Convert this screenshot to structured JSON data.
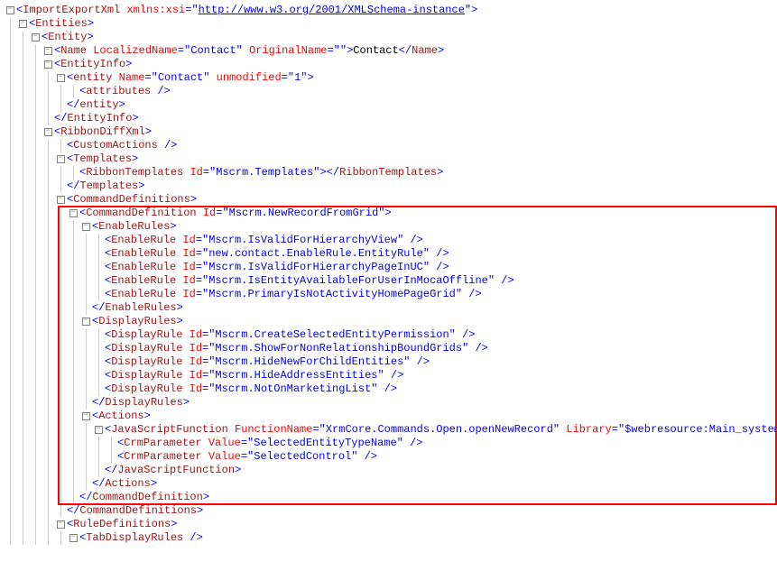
{
  "namespace_url": "http://www.w3.org/2001/XMLSchema-instance",
  "lines": [
    {
      "depth": 0,
      "type": "open",
      "content": [
        [
          "<",
          "ImportExportXml"
        ],
        [
          "attr",
          "xmlns:xsi"
        ],
        [
          "=",
          "\""
        ],
        [
          "link",
          "http://www.w3.org/2001/XMLSchema-instance"
        ],
        [
          "lit",
          "\""
        ],
        [
          ">",
          ""
        ]
      ]
    },
    {
      "depth": 1,
      "type": "open",
      "content": [
        [
          "<",
          "Entities"
        ],
        [
          ">",
          ""
        ]
      ]
    },
    {
      "depth": 2,
      "type": "open",
      "content": [
        [
          "<",
          "Entity"
        ],
        [
          ">",
          ""
        ]
      ]
    },
    {
      "depth": 3,
      "type": "open",
      "content": [
        [
          "<",
          "Name"
        ],
        [
          "attr",
          "LocalizedName"
        ],
        [
          "=",
          "\"Contact\""
        ],
        [
          "attr",
          "OriginalName"
        ],
        [
          "=",
          "\"\""
        ],
        [
          ">",
          ""
        ],
        [
          "txt",
          "Contact"
        ],
        [
          "</",
          "Name"
        ],
        [
          ">",
          ""
        ]
      ]
    },
    {
      "depth": 3,
      "type": "open",
      "content": [
        [
          "<",
          "EntityInfo"
        ],
        [
          ">",
          ""
        ]
      ]
    },
    {
      "depth": 4,
      "type": "open",
      "content": [
        [
          "<",
          "entity"
        ],
        [
          "attr",
          "Name"
        ],
        [
          "=",
          "\"Contact\""
        ],
        [
          "attr",
          "unmodified"
        ],
        [
          "=",
          "\"1\""
        ],
        [
          ">",
          ""
        ]
      ]
    },
    {
      "depth": 5,
      "type": "flat",
      "content": [
        [
          "<",
          "attributes"
        ],
        [
          "/>",
          ""
        ]
      ]
    },
    {
      "depth": 4,
      "type": "close",
      "content": [
        [
          "</",
          "entity"
        ],
        [
          ">",
          ""
        ]
      ]
    },
    {
      "depth": 3,
      "type": "close",
      "content": [
        [
          "</",
          "EntityInfo"
        ],
        [
          ">",
          ""
        ]
      ]
    },
    {
      "depth": 3,
      "type": "open",
      "content": [
        [
          "<",
          "RibbonDiffXml"
        ],
        [
          ">",
          ""
        ]
      ]
    },
    {
      "depth": 4,
      "type": "flat",
      "content": [
        [
          "<",
          "CustomActions"
        ],
        [
          "/>",
          ""
        ]
      ]
    },
    {
      "depth": 4,
      "type": "open",
      "content": [
        [
          "<",
          "Templates"
        ],
        [
          ">",
          ""
        ]
      ]
    },
    {
      "depth": 5,
      "type": "flat",
      "content": [
        [
          "<",
          "RibbonTemplates"
        ],
        [
          "attr",
          "Id"
        ],
        [
          "=",
          "\"Mscrm.Templates\""
        ],
        [
          ">",
          ""
        ],
        [
          "</",
          "RibbonTemplates"
        ],
        [
          ">",
          ""
        ]
      ]
    },
    {
      "depth": 4,
      "type": "close",
      "content": [
        [
          "</",
          "Templates"
        ],
        [
          ">",
          ""
        ]
      ]
    },
    {
      "depth": 4,
      "type": "open",
      "content": [
        [
          "<",
          "CommandDefinitions"
        ],
        [
          ">",
          ""
        ]
      ]
    },
    {
      "depth": 5,
      "type": "open",
      "hl": true,
      "content": [
        [
          "<",
          "CommandDefinition"
        ],
        [
          "attr",
          "Id"
        ],
        [
          "=",
          "\"Mscrm.NewRecordFromGrid\""
        ],
        [
          ">",
          ""
        ]
      ]
    },
    {
      "depth": 6,
      "type": "open",
      "hl": true,
      "content": [
        [
          "<",
          "EnableRules"
        ],
        [
          ">",
          ""
        ]
      ]
    },
    {
      "depth": 7,
      "type": "flat",
      "hl": true,
      "content": [
        [
          "<",
          "EnableRule"
        ],
        [
          "attr",
          "Id"
        ],
        [
          "=",
          "\"Mscrm.IsValidForHierarchyView\""
        ],
        [
          "/>",
          ""
        ]
      ]
    },
    {
      "depth": 7,
      "type": "flat",
      "hl": true,
      "content": [
        [
          "<",
          "EnableRule"
        ],
        [
          "attr",
          "Id"
        ],
        [
          "=",
          "\"new.contact.EnableRule.EntityRule\""
        ],
        [
          "/>",
          ""
        ]
      ]
    },
    {
      "depth": 7,
      "type": "flat",
      "hl": true,
      "content": [
        [
          "<",
          "EnableRule"
        ],
        [
          "attr",
          "Id"
        ],
        [
          "=",
          "\"Mscrm.IsValidForHierarchyPageInUC\""
        ],
        [
          "/>",
          ""
        ]
      ]
    },
    {
      "depth": 7,
      "type": "flat",
      "hl": true,
      "content": [
        [
          "<",
          "EnableRule"
        ],
        [
          "attr",
          "Id"
        ],
        [
          "=",
          "\"Mscrm.IsEntityAvailableForUserInMocaOffline\""
        ],
        [
          "/>",
          ""
        ]
      ]
    },
    {
      "depth": 7,
      "type": "flat",
      "hl": true,
      "content": [
        [
          "<",
          "EnableRule"
        ],
        [
          "attr",
          "Id"
        ],
        [
          "=",
          "\"Mscrm.PrimaryIsNotActivityHomePageGrid\""
        ],
        [
          "/>",
          ""
        ]
      ]
    },
    {
      "depth": 6,
      "type": "close",
      "hl": true,
      "content": [
        [
          "</",
          "EnableRules"
        ],
        [
          ">",
          ""
        ]
      ]
    },
    {
      "depth": 6,
      "type": "open",
      "hl": true,
      "content": [
        [
          "<",
          "DisplayRules"
        ],
        [
          ">",
          ""
        ]
      ]
    },
    {
      "depth": 7,
      "type": "flat",
      "hl": true,
      "content": [
        [
          "<",
          "DisplayRule"
        ],
        [
          "attr",
          "Id"
        ],
        [
          "=",
          "\"Mscrm.CreateSelectedEntityPermission\""
        ],
        [
          "/>",
          ""
        ]
      ]
    },
    {
      "depth": 7,
      "type": "flat",
      "hl": true,
      "content": [
        [
          "<",
          "DisplayRule"
        ],
        [
          "attr",
          "Id"
        ],
        [
          "=",
          "\"Mscrm.ShowForNonRelationshipBoundGrids\""
        ],
        [
          "/>",
          ""
        ]
      ]
    },
    {
      "depth": 7,
      "type": "flat",
      "hl": true,
      "content": [
        [
          "<",
          "DisplayRule"
        ],
        [
          "attr",
          "Id"
        ],
        [
          "=",
          "\"Mscrm.HideNewForChildEntities\""
        ],
        [
          "/>",
          ""
        ]
      ]
    },
    {
      "depth": 7,
      "type": "flat",
      "hl": true,
      "content": [
        [
          "<",
          "DisplayRule"
        ],
        [
          "attr",
          "Id"
        ],
        [
          "=",
          "\"Mscrm.HideAddressEntities\""
        ],
        [
          "/>",
          ""
        ]
      ]
    },
    {
      "depth": 7,
      "type": "flat",
      "hl": true,
      "content": [
        [
          "<",
          "DisplayRule"
        ],
        [
          "attr",
          "Id"
        ],
        [
          "=",
          "\"Mscrm.NotOnMarketingList\""
        ],
        [
          "/>",
          ""
        ]
      ]
    },
    {
      "depth": 6,
      "type": "close",
      "hl": true,
      "content": [
        [
          "</",
          "DisplayRules"
        ],
        [
          ">",
          ""
        ]
      ]
    },
    {
      "depth": 6,
      "type": "open",
      "hl": true,
      "content": [
        [
          "<",
          "Actions"
        ],
        [
          ">",
          ""
        ]
      ]
    },
    {
      "depth": 7,
      "type": "open",
      "hl": true,
      "content": [
        [
          "<",
          "JavaScriptFunction"
        ],
        [
          "attr",
          "FunctionName"
        ],
        [
          "=",
          "\"XrmCore.Commands.Open.openNewRecord\""
        ],
        [
          "attr",
          "Library"
        ],
        [
          "=",
          "\"$webresource:Main_system_library.js\""
        ]
      ]
    },
    {
      "depth": 8,
      "type": "flat",
      "hl": true,
      "content": [
        [
          "<",
          "CrmParameter"
        ],
        [
          "attr",
          "Value"
        ],
        [
          "=",
          "\"SelectedEntityTypeName\""
        ],
        [
          "/>",
          ""
        ]
      ]
    },
    {
      "depth": 8,
      "type": "flat",
      "hl": true,
      "content": [
        [
          "<",
          "CrmParameter"
        ],
        [
          "attr",
          "Value"
        ],
        [
          "=",
          "\"SelectedControl\""
        ],
        [
          "/>",
          ""
        ]
      ]
    },
    {
      "depth": 7,
      "type": "close",
      "hl": true,
      "content": [
        [
          "</",
          "JavaScriptFunction"
        ],
        [
          ">",
          ""
        ]
      ]
    },
    {
      "depth": 6,
      "type": "close",
      "hl": true,
      "content": [
        [
          "</",
          "Actions"
        ],
        [
          ">",
          ""
        ]
      ]
    },
    {
      "depth": 5,
      "type": "close",
      "hl": true,
      "content": [
        [
          "</",
          "CommandDefinition"
        ],
        [
          ">",
          ""
        ]
      ]
    },
    {
      "depth": 4,
      "type": "close",
      "content": [
        [
          "</",
          "CommandDefinitions"
        ],
        [
          ">",
          ""
        ]
      ]
    },
    {
      "depth": 4,
      "type": "open",
      "content": [
        [
          "<",
          "RuleDefinitions"
        ],
        [
          ">",
          ""
        ]
      ]
    },
    {
      "depth": 5,
      "type": "open",
      "content": [
        [
          "<",
          "TabDisplayRules"
        ],
        [
          "/>",
          ""
        ]
      ]
    }
  ]
}
